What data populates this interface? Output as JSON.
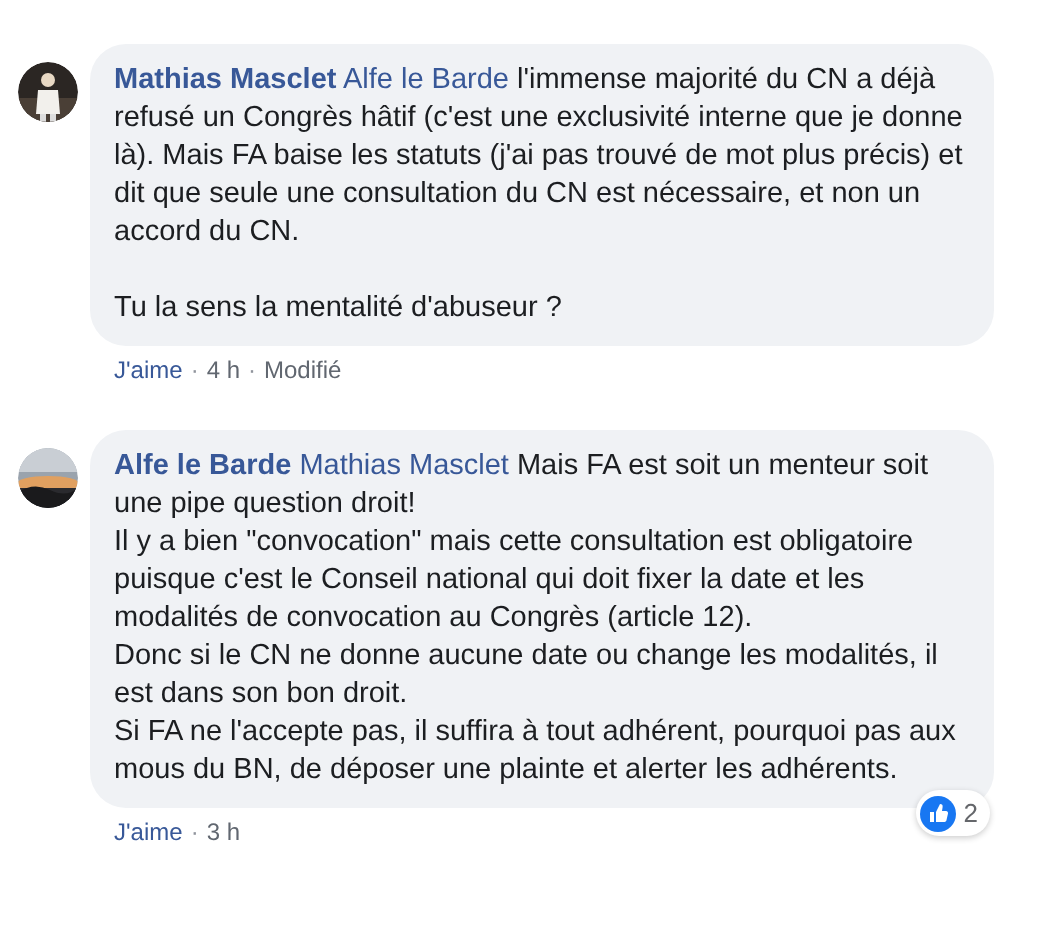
{
  "comments": [
    {
      "author": "Mathias Masclet",
      "mention": "Alfe le Barde",
      "avatar": {
        "kind": "picture"
      },
      "paragraphs": [
        [
          "l'immense majorité du CN a déjà refusé un Congrès hâtif (c'est une exclusivité interne que je donne là). Mais FA baise les statuts (j'ai pas trouvé de mot plus précis) et dit que seule une consultation du CN est nécessaire, et non un accord du CN."
        ],
        [
          "Tu la sens la mentalité d'abuseur ?"
        ]
      ],
      "footer": [
        "J'aime",
        "·",
        "4 h",
        "·",
        "Modifié"
      ]
    },
    {
      "author": "Alfe le Barde",
      "mention": "Mathias Masclet",
      "avatar": {
        "kind": "picture"
      },
      "paragraphs": [
        [
          "Mais FA est soit un menteur soit une pipe question droit!",
          "Il y a bien \"convocation\" mais cette consultation est obligatoire puisque c'est le Conseil national qui doit fixer la date et les modalités de convocation au Congrès (article 12).",
          "Donc si le CN ne donne aucune date ou change les modalités, il est dans son bon droit.",
          "Si FA ne l'accepte pas, il suffira à tout adhérent, pourquoi pas aux mous du BN, de déposer une plainte et alerter les adhérents."
        ]
      ],
      "footer": [
        "J'aime",
        "·",
        "3 h"
      ],
      "reactions": {
        "count": "2"
      }
    }
  ]
}
